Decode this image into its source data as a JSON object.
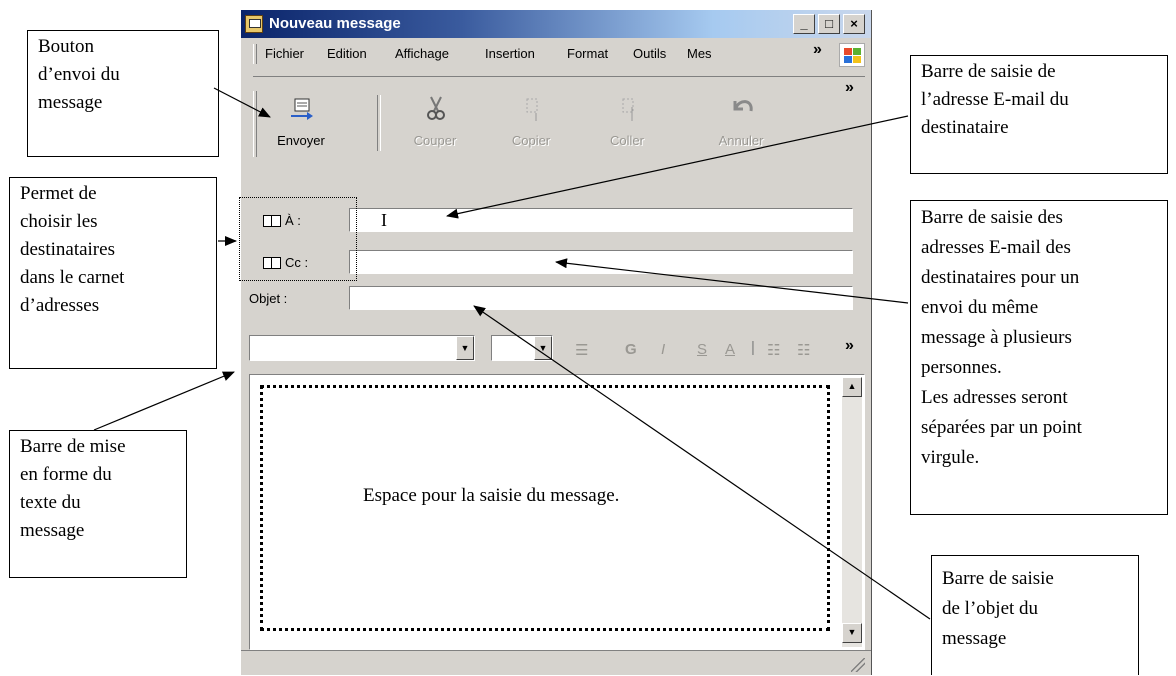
{
  "window": {
    "title": "Nouveau message",
    "controls": [
      "_",
      "□",
      "×"
    ]
  },
  "menu": {
    "items": [
      "Fichier",
      "Edition",
      "Affichage",
      "Insertion",
      "Format",
      "Outils",
      "Mes"
    ],
    "overflow": "»"
  },
  "toolbar": {
    "buttons": [
      {
        "label": "Envoyer",
        "icon": "send-icon",
        "enabled": true
      },
      {
        "label": "Couper",
        "icon": "scissors-icon",
        "enabled": false
      },
      {
        "label": "Copier",
        "icon": "copy-icon",
        "enabled": false
      },
      {
        "label": "Coller",
        "icon": "paste-icon",
        "enabled": false
      },
      {
        "label": "Annuler",
        "icon": "undo-icon",
        "enabled": false
      }
    ],
    "overflow": "»"
  },
  "headers": {
    "to_label": "À :",
    "cc_label": "Cc :",
    "subject_label": "Objet :",
    "to_value": "",
    "cc_value": "",
    "subject_value": ""
  },
  "format_toolbar": {
    "font_value": "",
    "size_value": "",
    "overflow": "»",
    "icons": [
      "paragraph-style-icon",
      "bold-icon",
      "italic-icon",
      "underline-icon",
      "font-color-icon",
      "numbered-list-icon",
      "bullet-list-icon"
    ],
    "bold": "G",
    "italic": "I",
    "underline": "S",
    "color": "A"
  },
  "message_body": "Espace pour la saisie du message.",
  "callouts": {
    "send": [
      "Bouton",
      "d’envoi du",
      "message"
    ],
    "address_book": [
      "Permet de",
      "choisir les",
      "destinataires",
      "dans le carnet",
      "d’adresses"
    ],
    "format_bar": [
      "Barre de mise",
      "en forme du",
      "texte du",
      "message"
    ],
    "to_field": [
      "Barre de saisie de",
      "l’adresse E-mail du",
      "destinataire"
    ],
    "cc_field": [
      "Barre de saisie des",
      "adresses E-mail des",
      "destinataires pour un",
      "envoi du même",
      "message à plusieurs",
      "personnes.",
      "Les adresses seront",
      "séparées par un point",
      "virgule."
    ],
    "subject_field": [
      "Barre de saisie",
      "de l’objet du",
      "message"
    ]
  },
  "colors": {
    "title_start": "#0a246a",
    "title_end": "#a6caf0",
    "window_face": "#d6d3ce"
  }
}
